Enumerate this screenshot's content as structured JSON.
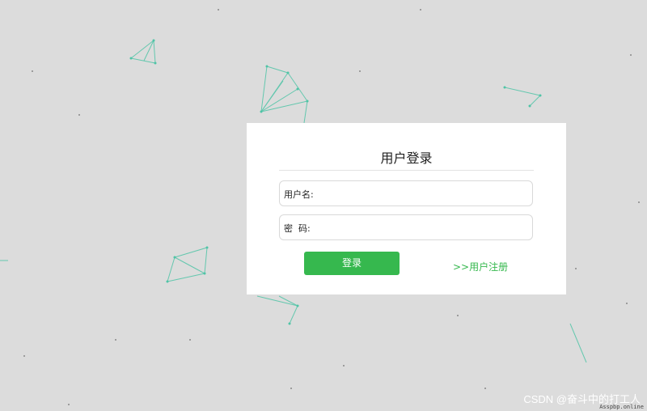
{
  "login": {
    "title": "用户登录",
    "username_label": "用户名:",
    "password_label": "密  码:",
    "login_button": "登录",
    "register_link": ">>用户注册"
  },
  "watermark": {
    "text": "CSDN @奋斗中的打工人",
    "sub": "Asspbp.online"
  },
  "colors": {
    "accent": "#36b84e",
    "network_line": "#4fc4a6",
    "background": "#dcdcdc"
  }
}
